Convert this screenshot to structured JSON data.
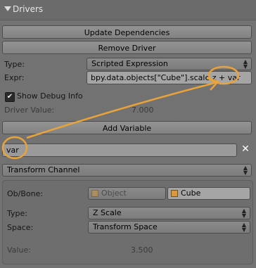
{
  "panel": {
    "title": "Drivers"
  },
  "buttons": {
    "update_dependencies": "Update Dependencies",
    "remove_driver": "Remove Driver",
    "add_variable": "Add Variable"
  },
  "driver": {
    "type_label": "Type:",
    "type_value": "Scripted Expression",
    "expr_label": "Expr:",
    "expr_value": "bpy.data.objects[\"Cube\"].scale.z + var",
    "show_debug_label": "Show Debug Info",
    "show_debug_checked": true,
    "driver_value_label": "Driver Value:",
    "driver_value": "7.000"
  },
  "variable": {
    "name": "var",
    "kind": "Transform Channel",
    "obbone_label": "Ob/Bone:",
    "object_placeholder": "Object",
    "object_value": "Cube",
    "type_label": "Type:",
    "type_value": "Z Scale",
    "space_label": "Space:",
    "space_value": "Transform Space",
    "value_label": "Value:",
    "value": "3.500"
  },
  "colors": {
    "annotation": "#e8a33a",
    "panel_bg": "#727272"
  }
}
